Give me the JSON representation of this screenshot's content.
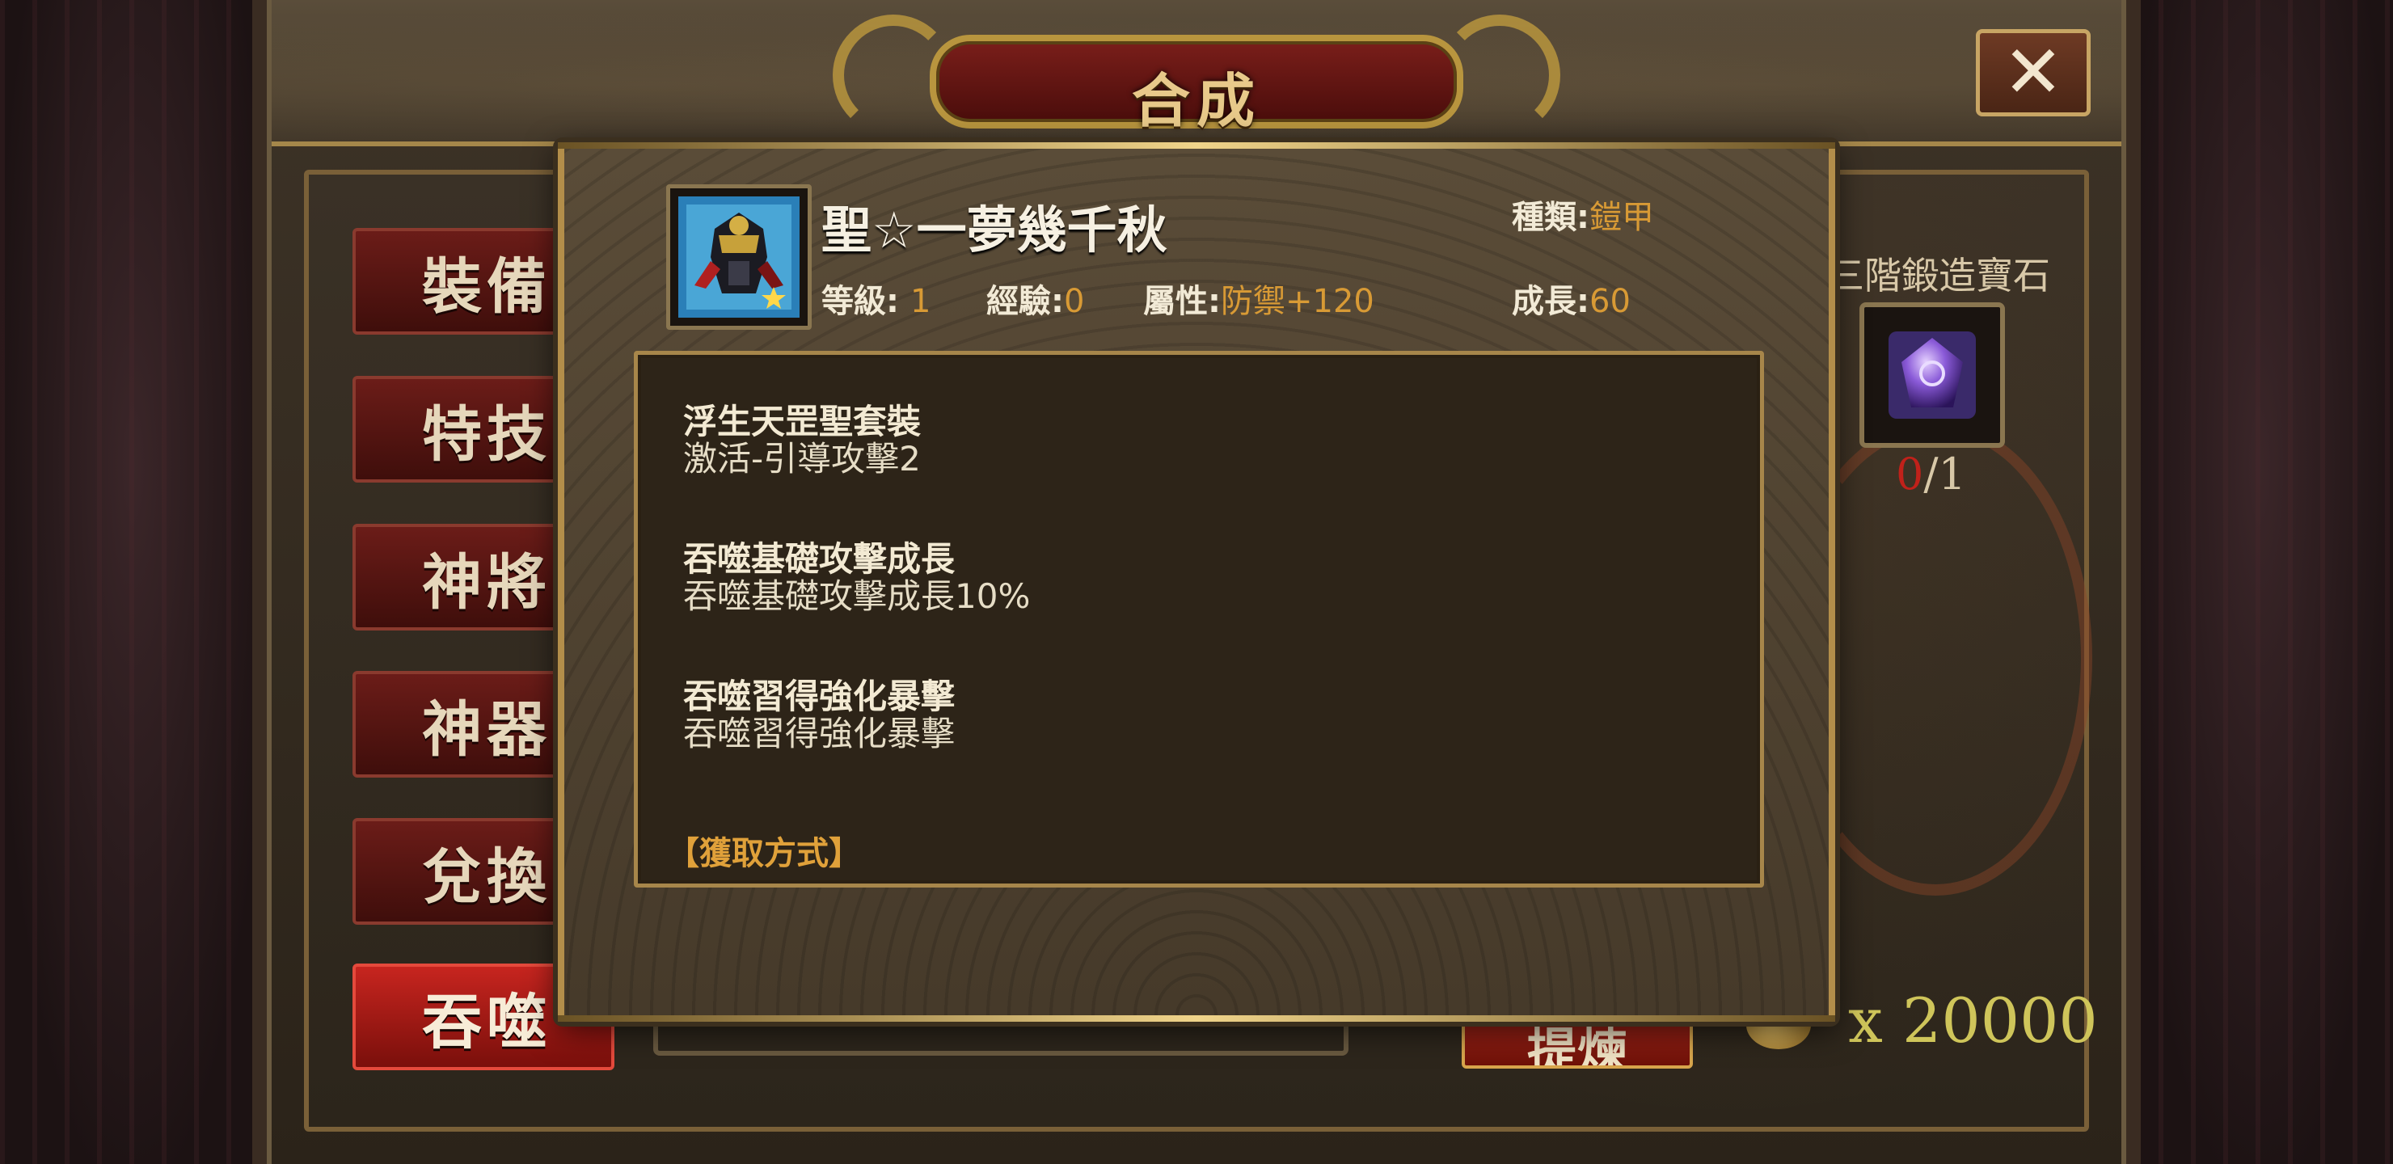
{
  "window": {
    "title": "合成",
    "close_label": "✕"
  },
  "nav": [
    {
      "label": "裝備",
      "active": false
    },
    {
      "label": "特技",
      "active": false
    },
    {
      "label": "神將",
      "active": false
    },
    {
      "label": "神器",
      "active": false
    },
    {
      "label": "兌換",
      "active": false
    },
    {
      "label": "吞噬",
      "active": true
    }
  ],
  "material": {
    "name": "三階鍛造寶石",
    "have": "0",
    "sep_need": "/1",
    "icon": "purple-gem-icon"
  },
  "cost": {
    "text": "x 20000",
    "icon": "gold-coin-icon"
  },
  "refine_button": {
    "label": "提煉"
  },
  "tooltip": {
    "item_name": "聖☆一夢幾千秋",
    "icon": "armored-warrior-icon",
    "type_label": "種類:",
    "type_value": "鎧甲",
    "level_label": "等級:",
    "level_value": "1",
    "exp_label": "經驗:",
    "exp_value": "0",
    "attr_label": "屬性:",
    "attr_value": "防禦+120",
    "growth_label": "成長:",
    "growth_value": "60",
    "skills": [
      {
        "name": "浮生天罡聖套裝",
        "desc": "激活-引導攻擊2"
      },
      {
        "name": "吞噬基礎攻擊成長",
        "desc": "吞噬基礎攻擊成長10%"
      },
      {
        "name": "吞噬習得強化暴擊",
        "desc": "吞噬習得強化暴擊"
      }
    ],
    "acquire_label": "【獲取方式】"
  },
  "colors": {
    "accent_gold": "#d89a35",
    "active_tab": "#c7251f",
    "count_missing": "#c0211a"
  }
}
